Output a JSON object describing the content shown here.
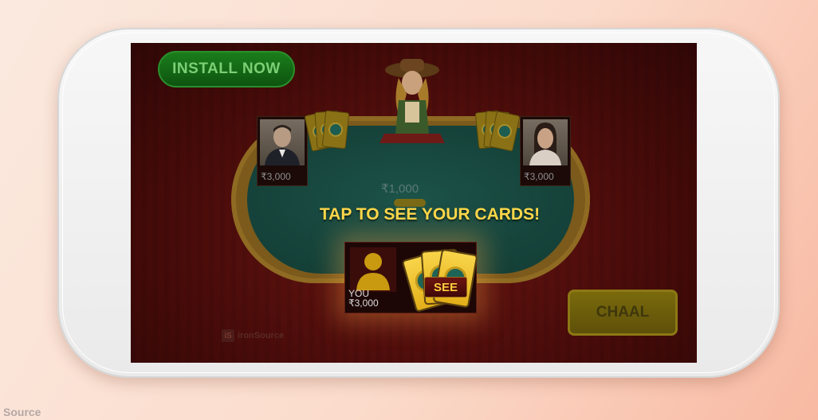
{
  "game": {
    "install_button": "INSTALL NOW",
    "prompt": "TAP TO SEE YOUR CARDS!",
    "pot_amount": "₹1,000",
    "see_button": "SEE",
    "chaal_button": "CHAAL",
    "brand": "ironSource",
    "brand_logo_text": "iS"
  },
  "players": {
    "left": {
      "chips": "₹3,000"
    },
    "right": {
      "chips": "₹3,000"
    },
    "you": {
      "label": "YOU",
      "chips": "₹3,000"
    }
  },
  "footer": {
    "source": "Source"
  },
  "colors": {
    "page_bg": "#fbe3d6",
    "table_felt": "#1c5349",
    "accent_gold": "#ffd84a",
    "install_green": "#1a7d1b"
  }
}
